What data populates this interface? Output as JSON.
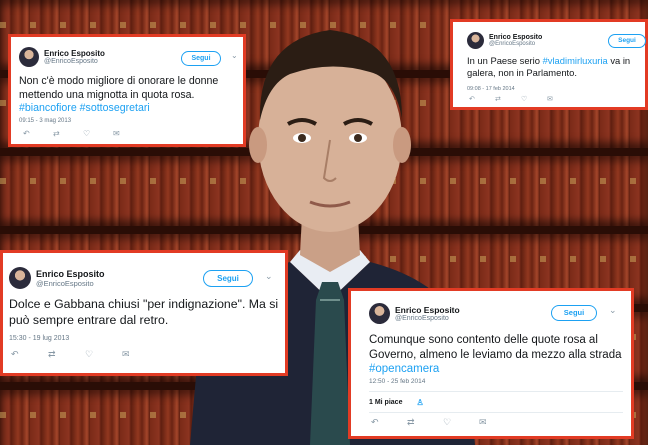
{
  "tweets": [
    {
      "user": "Enrico Esposito",
      "handle": "@EnricoEsposito",
      "follow_label": "Segui",
      "text_before": "Non c'è modo migliore di onorare le donne mettendo una mignotta in quota rosa.",
      "text_mid": "",
      "text_after": "",
      "tags": "#biancofiore #sottosegretari",
      "timestamp": "09:15 - 3 mag 2013"
    },
    {
      "user": "Enrico Esposito",
      "handle": "@EnricoEsposito",
      "follow_label": "Segui",
      "text_before": "In un Paese serio ",
      "tags": "#vladimirluxuria",
      "text_after": " va in galera, non in Parlamento.",
      "timestamp": "09:08 - 17 feb 2014"
    },
    {
      "user": "Enrico Esposito",
      "handle": "@EnricoEsposito",
      "follow_label": "Segui",
      "text_before": "Dolce e Gabbana chiusi \"per indignazione\". Ma si può sempre entrare dal retro.",
      "timestamp": "15:30 - 19 lug 2013"
    },
    {
      "user": "Enrico Esposito",
      "handle": "@EnricoEsposito",
      "follow_label": "Segui",
      "text_before": "Comunque sono contento delle quote rosa al Governo, almeno le leviamo da mezzo alla strada",
      "tags": "#opencamera",
      "timestamp": "12:50 - 25 feb 2014",
      "likes": "1 Mi piace"
    }
  ],
  "colors": {
    "accent": "#1da1f2",
    "frame": "#e23b24"
  }
}
